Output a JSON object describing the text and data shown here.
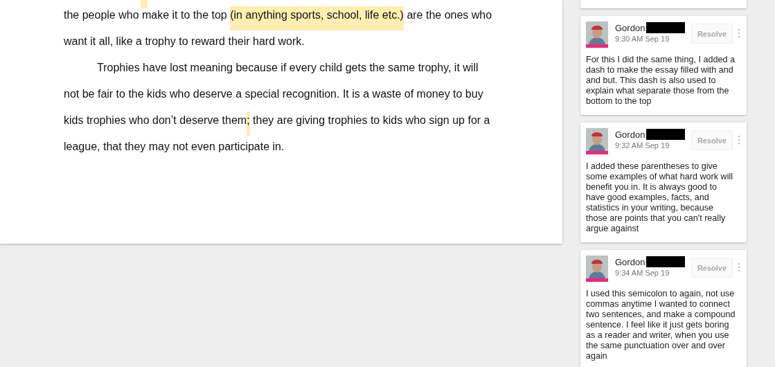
{
  "document": {
    "lines": [
      {
        "indent": false,
        "segments": [
          {
            "text": "the people who make it to the top ",
            "highlighted": false
          },
          {
            "text": "(in anything sports, school, life etc.)",
            "highlighted": true
          },
          {
            "text": " are the ones who",
            "highlighted": false
          }
        ]
      },
      {
        "indent": false,
        "segments": [
          {
            "text": "want it all, like a trophy to reward their hard work.",
            "highlighted": false
          }
        ]
      },
      {
        "indent": true,
        "segments": [
          {
            "text": "Trophies have lost meaning because if every child gets the same trophy, it will",
            "highlighted": false
          }
        ]
      },
      {
        "indent": false,
        "segments": [
          {
            "text": "not be fair to the kids who deserve a special recognition. It is a waste of money to buy",
            "highlighted": false
          }
        ]
      },
      {
        "indent": false,
        "segments": [
          {
            "text": "kids trophies who don’t deserve them",
            "highlighted": false
          },
          {
            "text": ";",
            "highlighted": true
          },
          {
            "text": " they are giving trophies to kids who sign up for a",
            "highlighted": false
          }
        ]
      },
      {
        "indent": false,
        "segments": [
          {
            "text": "league, that they may not even participate in.",
            "highlighted": false
          }
        ]
      }
    ]
  },
  "comments": [
    {
      "author": "Gordon",
      "time": "9:30 AM Sep 19",
      "color": "#f0277a",
      "resolve": "Resolve",
      "body": "For this I did the same thing, I added a dash to make the essay filled with and and but. This dash is also used to explain what separate those from the bottom to the top"
    },
    {
      "author": "Gordon",
      "time": "9:32 AM Sep 19",
      "color": "#f0277a",
      "resolve": "Resolve",
      "body": "I added these parentheses to give some examples of what hard work will benefit you in. It is always good to have good examples, facts, and statistics in your writing, because those are points that you can't really argue against"
    },
    {
      "author": "Gordon",
      "time": "9:34 AM Sep 19",
      "color": "#f0277a",
      "resolve": "Resolve",
      "body": "I used this semicolon to again, not use commas anytime I wanted to connect two sentences, and make a compound sentence. I feel like it just gets boring as a reader and writer, when you use the same punctuation over and over again"
    }
  ]
}
